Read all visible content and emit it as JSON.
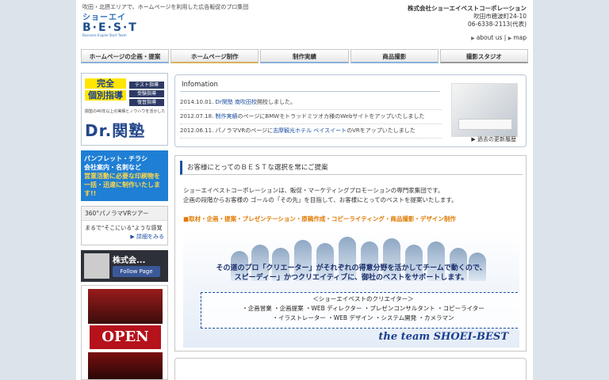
{
  "header": {
    "tagline": "吹田・北摂エリアで、ホームページを利用した広告販促のプロ集団",
    "logo_line1": "ショーエイ",
    "logo_line2": "B·E·S·T",
    "logo_line3": "Business Engine Start Team",
    "company_name": "株式会社ショーエイベストコーポレーション",
    "address": "吹田市穂波町24-10",
    "phone": "06-6338-2113(代表)",
    "links": [
      "about us",
      "map"
    ]
  },
  "nav": {
    "tabs": [
      "ホームページの企画・提案",
      "ホームページ制作",
      "制作実績",
      "商品撮影",
      "撮影スタジオ"
    ]
  },
  "sidebar": {
    "banner1": {
      "kanzen": [
        "完全",
        "個別指導"
      ],
      "features": [
        "テスト指導",
        "受験指導",
        "復習指導"
      ],
      "sub": "関塾の40年以上の実績とノウハウを活かした",
      "brand": "Dr.関塾"
    },
    "banner2": {
      "lines": [
        "パンフレット・チラシ",
        "会社案内・名刺など"
      ],
      "highlight": [
        "営業活動に必要な印刷物を",
        "一括・迅速に制作いたします!!"
      ]
    },
    "vr": {
      "title": "360°パノラマVRツアー",
      "body": "まるで\"そこにいる\"ような感覚",
      "more": "詳細をみる"
    },
    "facebook": {
      "company": "株式会...",
      "button": "Follow Page"
    },
    "poster": {
      "label": "OPEN"
    }
  },
  "info": {
    "title": "Infomation",
    "items": [
      {
        "date": "2014.10.01.",
        "link": "Dr関塾 南吹田校",
        "text": "開校しました。"
      },
      {
        "date": "2012.07.18.",
        "link": "制作実績",
        "text": "のページにBMWモトラッドミツオカ様のWebサイトをアップいたしました"
      },
      {
        "date": "2012.06.11.",
        "link": "志摩観光ホテル ベイスイート",
        "pre": "パノラマVRのページに",
        "text": "のVRをアップいたしました"
      }
    ],
    "archive": "過去の更新履歴"
  },
  "main": {
    "heading": "お客様にとってのＢＥＳＴな選択を常にご提案",
    "intro1": "ショーエイベストコーポレーションは、販促・マーケティングプロモーションの専門家集団です。",
    "intro2": "企画の段階からお客様の ゴールの「その先」を目指して、お客様にとってのベストを提案いたします。",
    "services": "■取材・企画・提案・プレゼンテーション・原稿作成・コピーライティング・商品撮影・デザイン制作",
    "slogan1": "その道のプロ「クリエーター」がそれぞれの得意分野を活かしてチームで動くので、",
    "slogan2": "スピーディー」かつクリエイティブに、御社のベストをサポートします。",
    "creators_title": "＜ショーエイベストのクリエイター＞",
    "creators1": "・企画営業 ・企画提案 ・WEB ディレクター ・プレゼンコンサルタント ・コピーライター",
    "creators2": "・イラストレーター ・WEB デザイン ・システム開発 ・カメラマン",
    "signature": "the team SHOEI-BEST"
  }
}
